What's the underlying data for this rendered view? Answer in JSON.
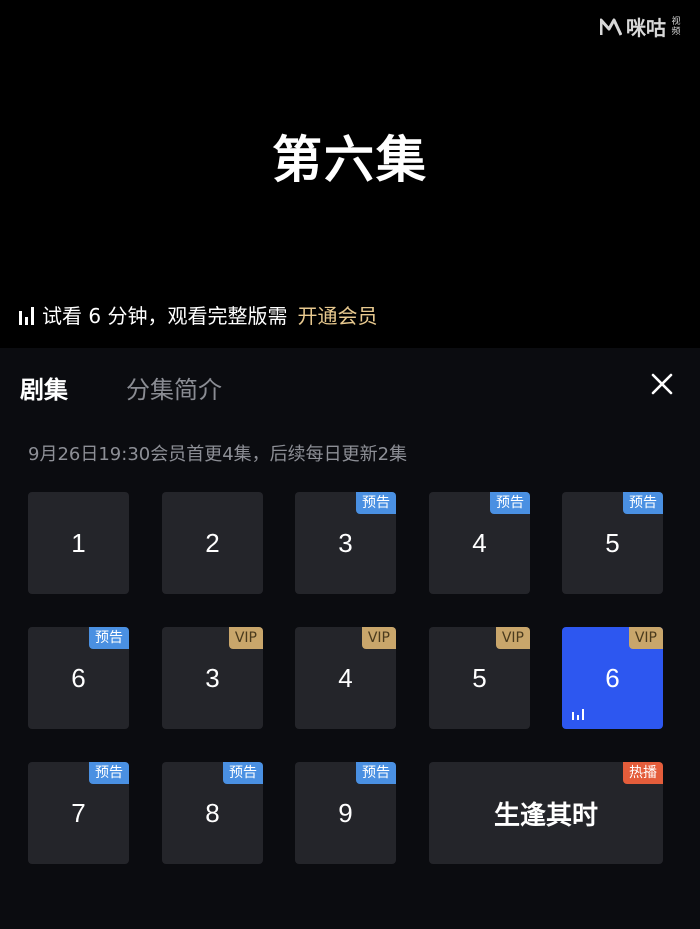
{
  "logo": {
    "name": "咪咕",
    "sub": "视频"
  },
  "player": {
    "episode_title": "第六集",
    "trial_text": "试看 6 分钟，观看完整版需",
    "trial_cta": "开通会员"
  },
  "tabs": [
    {
      "label": "剧集",
      "active": true
    },
    {
      "label": "分集简介",
      "active": false
    }
  ],
  "schedule": "9月26日19:30会员首更4集，后续每日更新2集",
  "episodes": [
    {
      "label": "1",
      "badge": ""
    },
    {
      "label": "2",
      "badge": ""
    },
    {
      "label": "3",
      "badge": "预告"
    },
    {
      "label": "4",
      "badge": "预告"
    },
    {
      "label": "5",
      "badge": "预告"
    },
    {
      "label": "6",
      "badge": "预告"
    },
    {
      "label": "3",
      "badge": "VIP"
    },
    {
      "label": "4",
      "badge": "VIP"
    },
    {
      "label": "5",
      "badge": "VIP"
    },
    {
      "label": "6",
      "badge": "VIP",
      "playing": true
    },
    {
      "label": "7",
      "badge": "预告"
    },
    {
      "label": "8",
      "badge": "预告"
    },
    {
      "label": "9",
      "badge": "预告"
    },
    {
      "label": "生逢其时",
      "badge": "热播"
    }
  ]
}
